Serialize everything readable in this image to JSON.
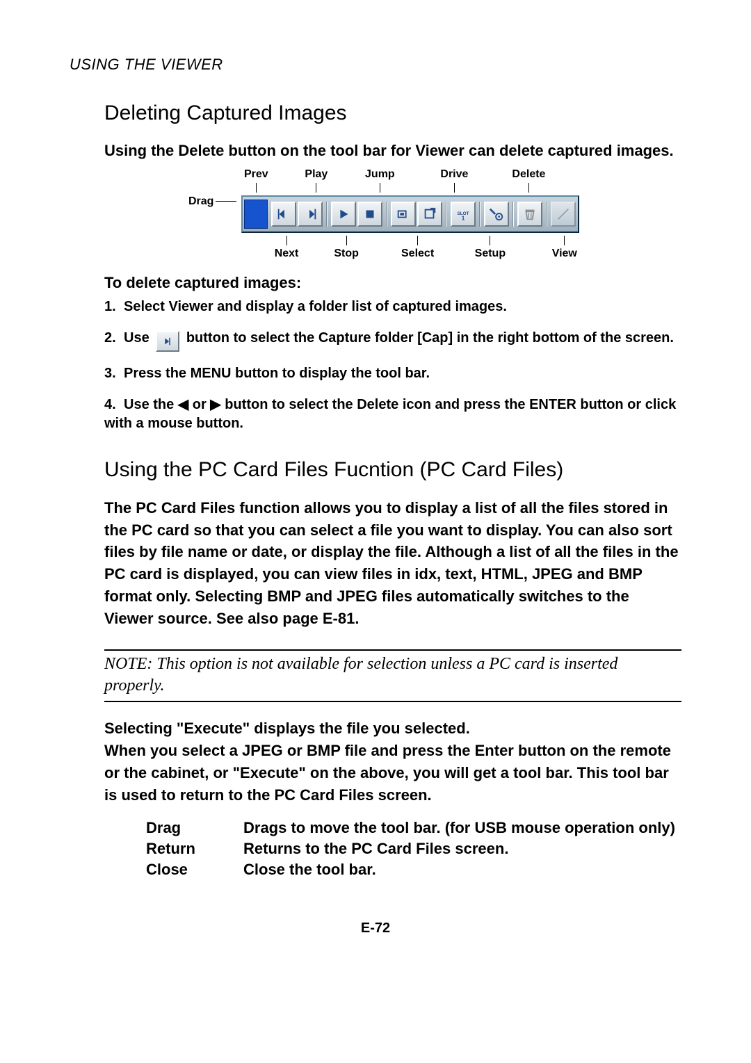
{
  "running_head": "USING THE VIEWER",
  "section1": {
    "title": "Deleting Captured Images",
    "intro": "Using the Delete button on the tool bar for Viewer can delete captured images.",
    "diagram": {
      "side_label": "Drag",
      "top": [
        "Prev",
        "Play",
        "Jump",
        "Drive",
        "Delete"
      ],
      "bottom": [
        "Next",
        "Stop",
        "Select",
        "Setup",
        "View"
      ]
    },
    "subhead": "To delete captured images:",
    "steps": [
      {
        "n": "1.",
        "text": "Select Viewer and display a folder list of captured images."
      },
      {
        "n": "2.",
        "pre": "Use",
        "post": "button to select the Capture folder [Cap] in the right bottom of the screen."
      },
      {
        "n": "3.",
        "text": "Press the MENU button to display the tool bar."
      },
      {
        "n": "4.",
        "text": "Use the ◀ or ▶ button to select the Delete icon and press the ENTER button or click with a mouse button."
      }
    ]
  },
  "section2": {
    "title": "Using the PC Card Files Fucntion (PC Card Files)",
    "body": "The PC Card Files function allows you to display a list of all the files stored in the PC card so that you can select a file you want to display. You can also sort files by file name or date, or display the file. Although a list of all the files in the PC card is displayed, you can view files in idx, text, HTML, JPEG and BMP format only. Selecting BMP and JPEG files automatically switches to the Viewer source. See also page E-81.",
    "note": "NOTE: This option is not available for selection unless a PC card is inserted properly.",
    "after_note": "Selecting \"Execute\" displays the file you selected.\nWhen you select a JPEG or BMP file and press the Enter button on the remote or the cabinet, or \"Execute\" on the above, you will get a tool bar. This tool bar is used to return to the PC Card Files screen.",
    "dl": [
      {
        "term": "Drag",
        "def": "Drags to move the tool bar. (for USB mouse operation only)"
      },
      {
        "term": "Return",
        "def": "Returns to the PC Card Files screen."
      },
      {
        "term": "Close",
        "def": "Close the tool bar."
      }
    ]
  },
  "page_number": "E-72"
}
